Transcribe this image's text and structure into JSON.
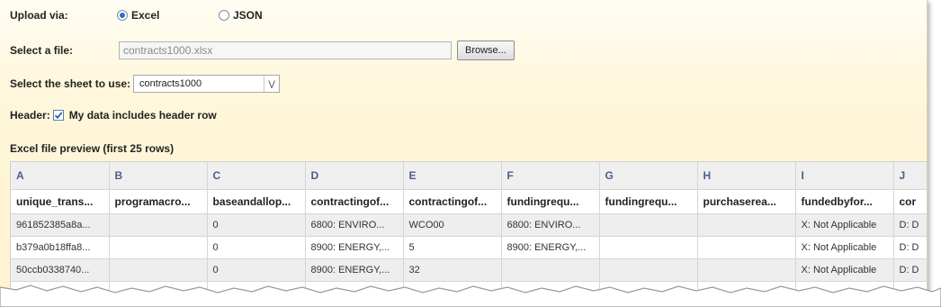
{
  "upload": {
    "label": "Upload via:",
    "options": [
      {
        "label": "Excel",
        "selected": true
      },
      {
        "label": "JSON",
        "selected": false
      }
    ]
  },
  "file": {
    "label": "Select a file:",
    "value": "contracts1000.xlsx",
    "browse_label": "Browse..."
  },
  "sheet": {
    "label": "Select the sheet to use:",
    "selected": "contracts1000"
  },
  "header_opt": {
    "label": "Header:",
    "checkbox_label": "My data includes header row",
    "checked": true
  },
  "preview": {
    "title": "Excel file preview (first 25 rows)",
    "columns": [
      "A",
      "B",
      "C",
      "D",
      "E",
      "F",
      "G",
      "H",
      "I",
      "J"
    ],
    "header_row": [
      "unique_trans...",
      "programacro...",
      "baseandallop...",
      "contractingof...",
      "contractingof...",
      "fundingrequ...",
      "fundingrequ...",
      "purchaserea...",
      "fundedbyfor...",
      "cor"
    ],
    "rows": [
      [
        "961852385a8a...",
        "",
        "0",
        "6800: ENVIRO...",
        "WCO00",
        "6800: ENVIRO...",
        "",
        "",
        "X: Not Applicable",
        "D: D"
      ],
      [
        "b379a0b18ffa8...",
        "",
        "0",
        "8900: ENERGY,...",
        "5",
        "8900: ENERGY,...",
        "",
        "",
        "X: Not Applicable",
        "D: D"
      ],
      [
        "50ccb0338740...",
        "",
        "0",
        "8900: ENERGY,...",
        "32",
        "",
        "",
        "",
        "X: Not Applicable",
        "D: D"
      ]
    ]
  },
  "colors": {
    "accent": "#2d6fce",
    "header_text": "#4a5f8a",
    "panel_bg": "#fff6d8"
  }
}
